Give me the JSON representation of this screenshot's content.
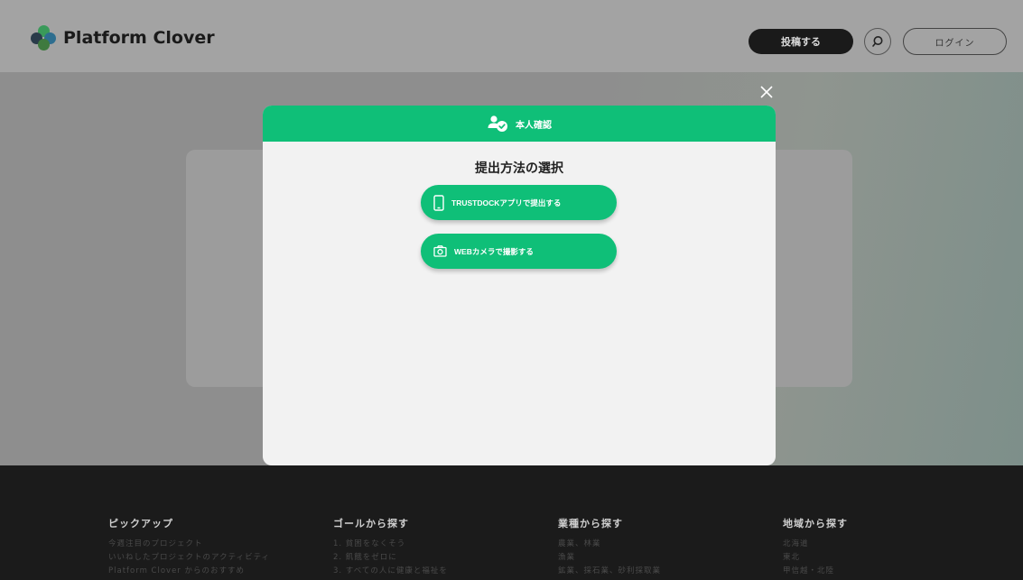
{
  "header": {
    "logo_text": "Platform Clover",
    "post_label": "投稿する",
    "login_label": "ログイン"
  },
  "modal": {
    "header_title": "本人確認",
    "title": "提出方法の選択",
    "options": [
      {
        "label": "TRUSTDOCKアプリで提出する",
        "icon": "smartphone-icon"
      },
      {
        "label": "WEBカメラで撮影する",
        "icon": "camera-icon"
      }
    ],
    "close_icon": "close-icon"
  },
  "footer": {
    "columns": [
      {
        "heading": "ピックアップ",
        "items": [
          "今週注目のプロジェクト",
          "いいねしたプロジェクトのアクティビティ",
          "Platform Clover からのおすすめ"
        ]
      },
      {
        "heading": "ゴールから探す",
        "items": [
          "1. 貧困をなくそう",
          "2. 飢餓をゼロに",
          "3. すべての人に健康と福祉を"
        ]
      },
      {
        "heading": "業種から探す",
        "items": [
          "農業、林業",
          "漁業",
          "鉱業、採石業、砂利採取業"
        ]
      },
      {
        "heading": "地域から探す",
        "items": [
          "北海道",
          "東北",
          "甲信越・北陸"
        ]
      }
    ]
  },
  "colors": {
    "accent": "#0fbf78",
    "footer_bg": "#1b1b1b",
    "overlay": "#8c8c8c"
  }
}
